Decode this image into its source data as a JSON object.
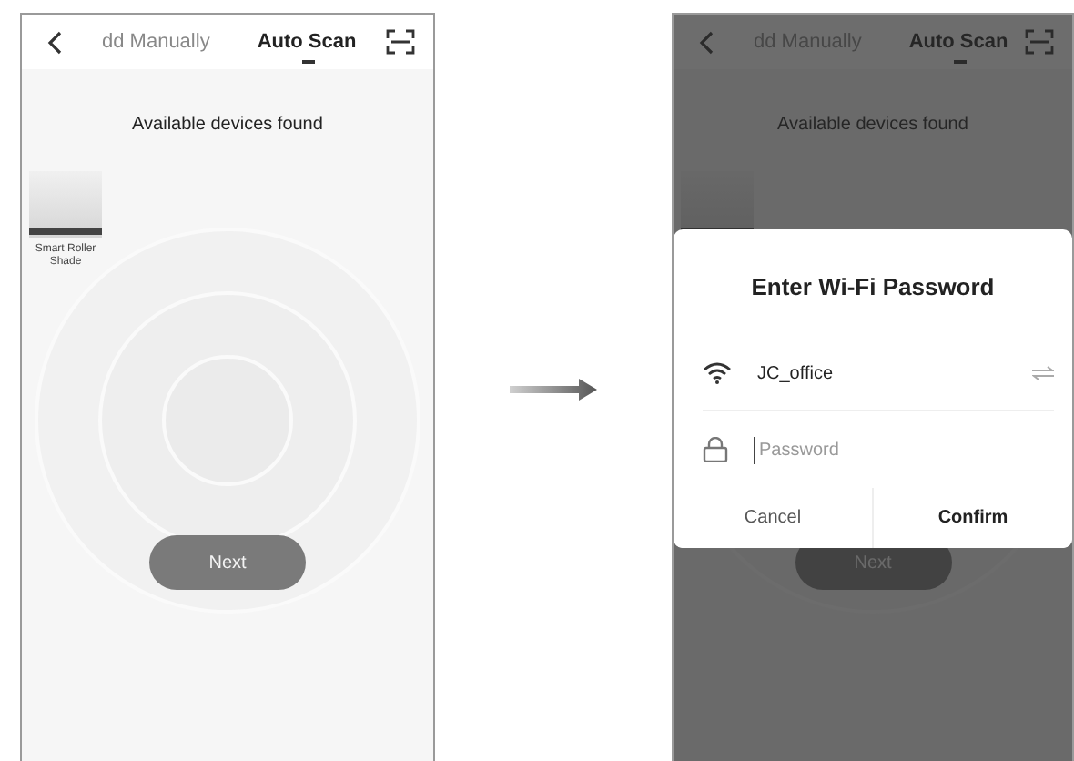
{
  "screens": [
    {
      "dimmed": false,
      "tabs": [
        {
          "label": "dd Manually",
          "selected": false
        },
        {
          "label": "Auto Scan",
          "selected": true
        }
      ],
      "heading": "Available devices found",
      "device": {
        "name": "Smart Roller Shade"
      },
      "next_button": "Next"
    },
    {
      "dimmed": true,
      "tabs": [
        {
          "label": "dd Manually",
          "selected": false
        },
        {
          "label": "Auto Scan",
          "selected": true
        }
      ],
      "heading": "Available devices found",
      "next_button": "Next",
      "dialog": {
        "title": "Enter Wi-Fi Password",
        "network": "JC_office",
        "password": {
          "placeholder": "Password"
        },
        "buttons": [
          "Cancel",
          "Confirm"
        ]
      }
    }
  ]
}
